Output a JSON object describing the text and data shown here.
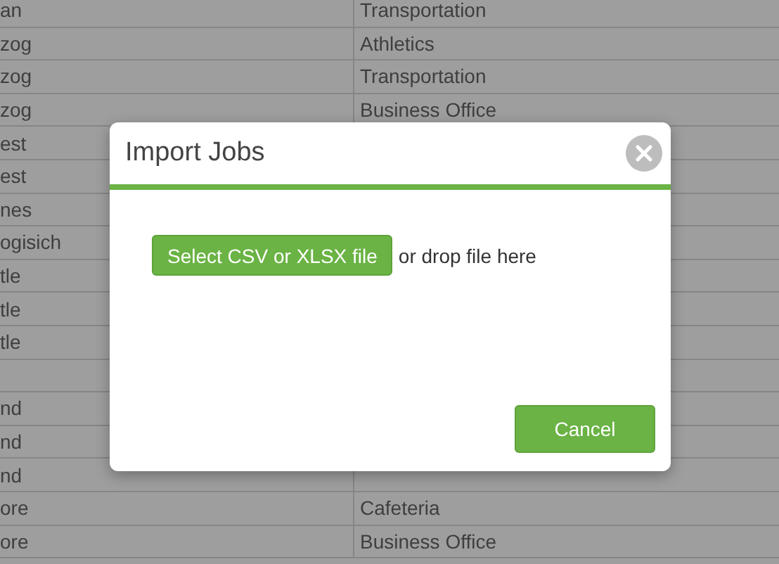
{
  "table": {
    "rows": [
      {
        "column_1": "an",
        "column_2": "Transportation"
      },
      {
        "column_1": "zog",
        "column_2": "Athletics"
      },
      {
        "column_1": "zog",
        "column_2": "Transportation"
      },
      {
        "column_1": "zog",
        "column_2": "Business Office"
      },
      {
        "column_1": "est"
      },
      {
        "column_1": "est"
      },
      {
        "column_1": "nes"
      },
      {
        "column_1": "ogisich"
      },
      {
        "column_1": "tle"
      },
      {
        "column_1": "tle"
      },
      {
        "column_1": "tle"
      },
      {},
      {
        "column_1": "nd"
      },
      {
        "column_1": "nd"
      },
      {
        "column_1": "nd"
      },
      {
        "column_1": "ore",
        "column_2": "Cafeteria"
      },
      {
        "column_1": "ore",
        "column_2": "Business Office"
      }
    ]
  },
  "dialog": {
    "title": "Import Jobs",
    "select_button": "Select CSV or XLSX file",
    "drop_hint": "or drop file here",
    "cancel_button": "Cancel"
  }
}
